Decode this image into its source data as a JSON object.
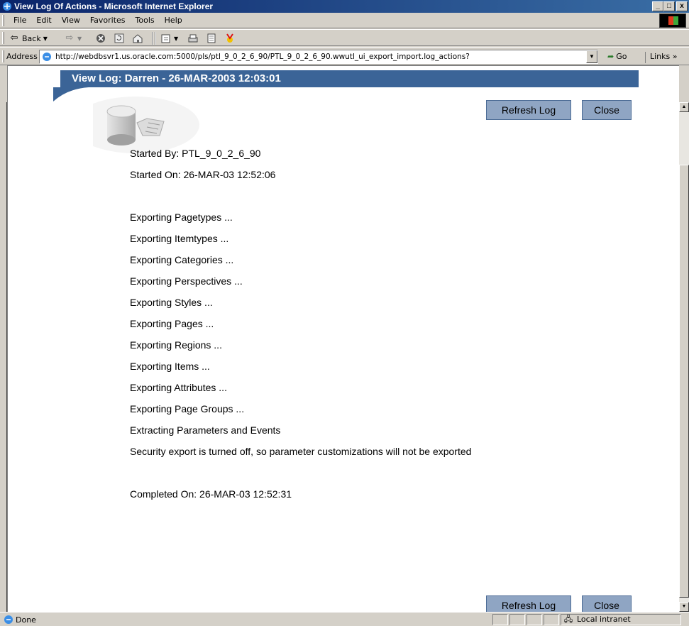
{
  "window": {
    "title": "View Log Of Actions - Microsoft Internet Explorer",
    "min": "_",
    "max": "□",
    "close": "x"
  },
  "menu": [
    "File",
    "Edit",
    "View",
    "Favorites",
    "Tools",
    "Help"
  ],
  "toolbar": {
    "back_label": "Back",
    "icons": [
      "back-icon",
      "forward-icon",
      "stop-icon",
      "refresh-icon",
      "home-icon",
      "edit-icon",
      "print-icon",
      "page-icon",
      "messenger-icon"
    ]
  },
  "address": {
    "label": "Address",
    "url": "http://webdbsvr1.us.oracle.com:5000/pls/ptl_9_0_2_6_90/PTL_9_0_2_6_90.wwutl_ui_export_import.log_actions?",
    "go_label": "Go",
    "links_label": "Links »"
  },
  "page": {
    "banner_title": "View Log: Darren - 26-MAR-2003 12:03:01",
    "refresh_label": "Refresh Log",
    "close_label": "Close",
    "log": {
      "started_by": "Started By: PTL_9_0_2_6_90",
      "started_on": "Started On: 26-MAR-03 12:52:06",
      "lines": [
        "Exporting Pagetypes ...",
        "Exporting Itemtypes ...",
        "Exporting Categories ...",
        "Exporting Perspectives ...",
        "Exporting Styles ...",
        "Exporting Pages ...",
        "Exporting Regions ...",
        "Exporting Items ...",
        "Exporting Attributes ...",
        "Exporting Page Groups ...",
        "Extracting Parameters and Events",
        "Security export is turned off, so parameter customizations will not be exported"
      ],
      "completed_on": "Completed On: 26-MAR-03 12:52:31"
    }
  },
  "status": {
    "text": "Done",
    "zone": "Local intranet"
  },
  "colors": {
    "banner": "#3b6497",
    "button": "#8fa5c3",
    "chrome": "#d4d0c8"
  }
}
